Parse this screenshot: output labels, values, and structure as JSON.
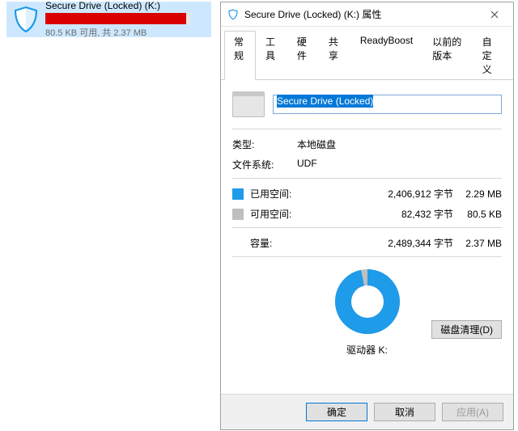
{
  "drive_item": {
    "title": "Secure Drive (Locked) (K:)",
    "subtext": "80.5 KB 可用, 共 2.37 MB",
    "fill_percent": 96.7
  },
  "dialog": {
    "title": "Secure Drive (Locked) (K:) 属性",
    "tabs": {
      "general": "常规",
      "tools": "工具",
      "hardware": "硬件",
      "sharing": "共享",
      "readyboost": "ReadyBoost",
      "previous": "以前的版本",
      "custom": "自定义"
    },
    "name_value": "Secure Drive (Locked)",
    "type_label": "类型:",
    "type_value": "本地磁盘",
    "fs_label": "文件系统:",
    "fs_value": "UDF",
    "used": {
      "label": "已用空间:",
      "bytes": "2,406,912 字节",
      "size": "2.29 MB",
      "color": "#1e9be9"
    },
    "free": {
      "label": "可用空间:",
      "bytes": "82,432 字节",
      "size": "80.5 KB",
      "color": "#bfbfbf"
    },
    "capacity": {
      "label": "容量:",
      "bytes": "2,489,344 字节",
      "size": "2.37 MB"
    },
    "drive_label": "驱动器 K:",
    "disk_cleanup": "磁盘清理(D)",
    "buttons": {
      "ok": "确定",
      "cancel": "取消",
      "apply": "应用(A)"
    }
  },
  "chart_data": {
    "type": "pie",
    "title": "驱动器 K:",
    "series": [
      {
        "name": "已用空间",
        "value": 2406912,
        "color": "#1e9be9"
      },
      {
        "name": "可用空间",
        "value": 82432,
        "color": "#bfbfbf"
      }
    ]
  }
}
